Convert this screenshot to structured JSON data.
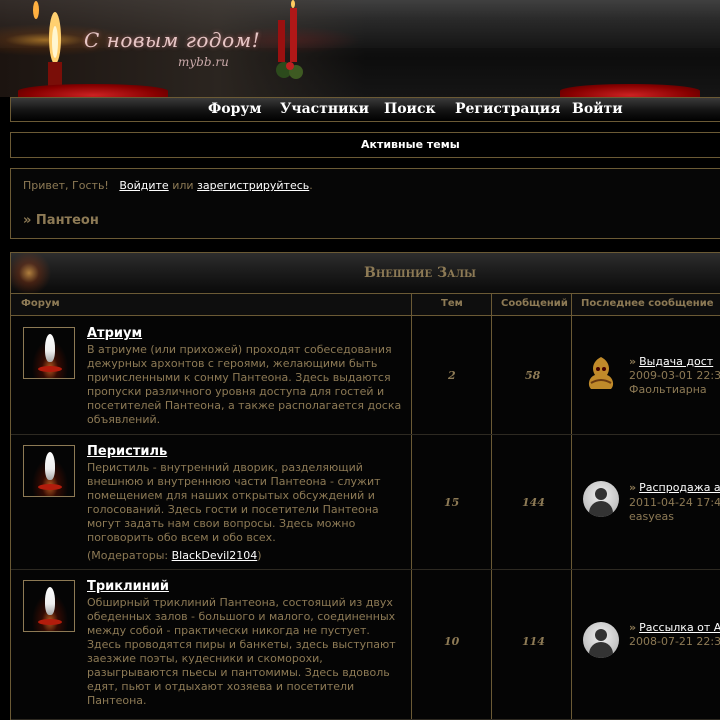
{
  "banner": {
    "title": "С новым годом!",
    "subtitle": "mybb.ru"
  },
  "nav": {
    "items": [
      "Форум",
      "Участники",
      "Поиск",
      "Регистрация",
      "Войти"
    ]
  },
  "active_topics": "Активные темы",
  "welcome": {
    "greeting": "Привет, Гость!",
    "login_link": "Войдите",
    "or": "или",
    "register_link": "зарегистрируйтесь",
    "period": ".",
    "breadcrumb": "» Пантеон"
  },
  "category": {
    "title": "Внешние Залы",
    "columns": {
      "forum": "Форум",
      "topics": "Тем",
      "posts": "Сообщений",
      "last_post": "Последнее сообщение"
    },
    "forums": [
      {
        "name": "Атриум",
        "description": "В атриуме (или прихожей) проходят собеседования дежурных архонтов с героями, желающими быть причисленными к сонму Пантеона. Здесь выдаются пропуски различного уровня доступа для гостей и посетителей Пантеона, а также располагается доска объявлений.",
        "topics": "2",
        "posts": "58",
        "last_title": "Выдача дост",
        "last_date": "2009-03-01 22:3",
        "last_user": "Фаольтиарна"
      },
      {
        "name": "Перистиль",
        "description": "Перистиль - внутренний дворик, разделяющий внешнюю и внутреннюю части Пантеона - служит помещением для наших открытых обсуждений и голосований. Здесь гости и посетители Пантеона могут задать нам свои вопросы. Здесь можно поговорить обо всем и обо всех.",
        "moderators_label": "(Модераторы: ",
        "moderator": "BlackDevil2104",
        "moderators_close": ")",
        "topics": "15",
        "posts": "144",
        "last_title": "Распродажа а",
        "last_date": "2011-04-24 17:4",
        "last_user": "easyeas"
      },
      {
        "name": "Триклиний",
        "description": "Обширный триклиний Пантеона, состоящий из двух обеденных залов - большого и малого, соединенных между собой - практически никогда не пустует. Здесь проводятся пиры и банкеты, здесь выступают заезжие поэты, кудесники и скоморохи, разыгрываются пьесы и пантомимы. Здесь вдоволь едят, пьют и отдыхают хозяева и посетители Пантеона.",
        "topics": "10",
        "posts": "114",
        "last_title": "Рассылка от А",
        "last_date": "2008-07-21 22:3",
        "last_user": ""
      }
    ]
  }
}
